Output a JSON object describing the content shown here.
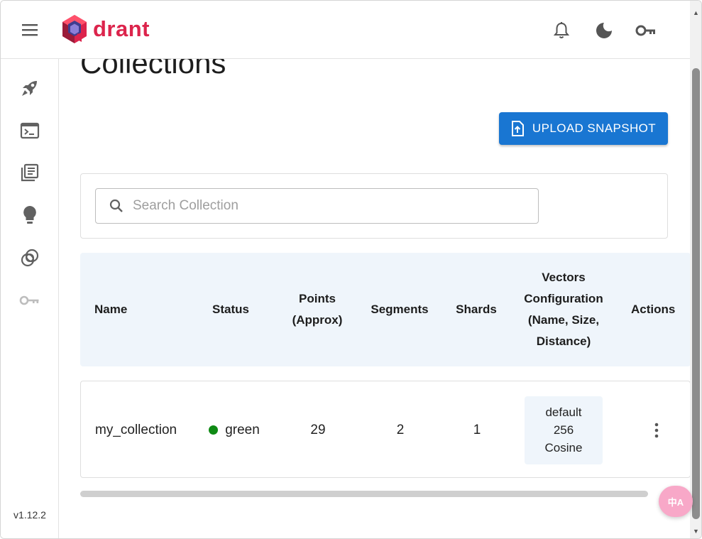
{
  "app": {
    "logo_text": "drant",
    "version": "v1.12.2"
  },
  "header": {
    "icons": [
      "menu-icon",
      "bell-icon",
      "moon-icon",
      "key-icon"
    ]
  },
  "sidebar": {
    "items": [
      {
        "icon": "rocket-icon",
        "active": false
      },
      {
        "icon": "terminal-icon",
        "active": false
      },
      {
        "icon": "library-icon",
        "active": false
      },
      {
        "icon": "lightbulb-icon",
        "active": false
      },
      {
        "icon": "rings-icon",
        "active": false
      },
      {
        "icon": "key-icon",
        "active": false
      }
    ]
  },
  "main": {
    "title": "Collections",
    "upload_label": "UPLOAD SNAPSHOT",
    "search_placeholder": "Search Collection"
  },
  "table": {
    "headers": {
      "name": "Name",
      "status": "Status",
      "points": "Points (Approx)",
      "segments": "Segments",
      "shards": "Shards",
      "vectors": "Vectors Configuration (Name, Size, Distance)",
      "actions": "Actions"
    },
    "rows": [
      {
        "name": "my_collection",
        "status": "green",
        "points": "29",
        "segments": "2",
        "shards": "1",
        "vector_name": "default",
        "vector_size": "256",
        "vector_distance": "Cosine"
      }
    ]
  },
  "colors": {
    "brand": "#dc244c",
    "primary": "#1976d2",
    "status_green": "#0f8a14",
    "header_bg": "#eff5fb"
  },
  "fab": {
    "label": "中A"
  }
}
